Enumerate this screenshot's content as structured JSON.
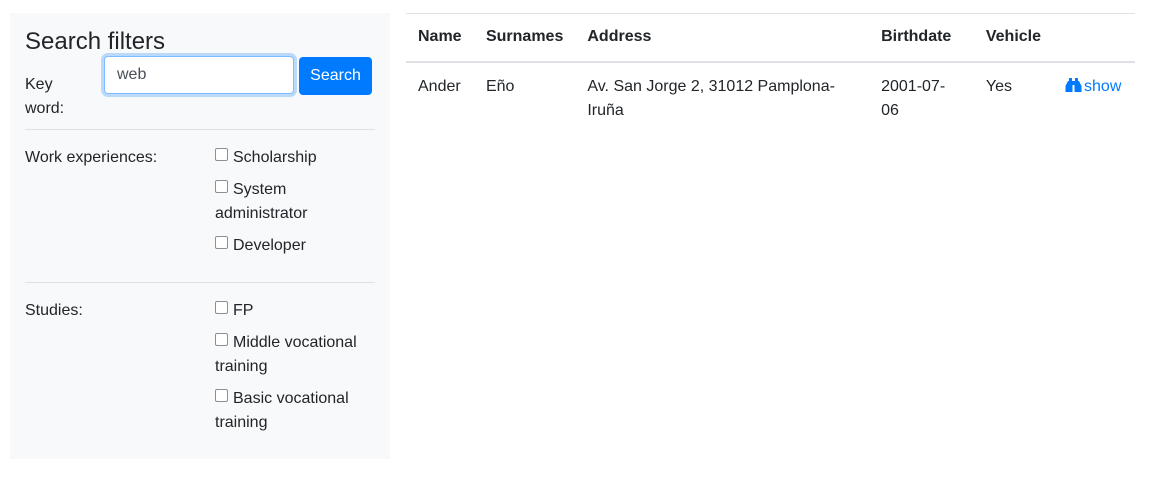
{
  "sidebar": {
    "title": "Search filters",
    "keyword_label": "Key word:",
    "keyword_value": "web",
    "search_button": "Search",
    "work_label": "Work experiences:",
    "work_options": [
      "Scholarship",
      "System administrator",
      "Developer"
    ],
    "studies_label": "Studies:",
    "studies_options": [
      "FP",
      "Middle vocational training",
      "Basic vocational training"
    ]
  },
  "table": {
    "headers": [
      "Name",
      "Surnames",
      "Address",
      "Birthdate",
      "Vehicle",
      ""
    ],
    "rows": [
      {
        "name": "Ander",
        "surnames": "Eño",
        "address": "Av. San Jorge 2, 31012 Pamplona-Iruña",
        "birthdate": "2001-07-06",
        "vehicle": "Yes",
        "action": "show",
        "action_icon": "binoculars-icon"
      }
    ]
  },
  "colors": {
    "accent": "#007bff",
    "sidebar_bg": "#f8f9fa",
    "divider": "#dee2e6"
  }
}
